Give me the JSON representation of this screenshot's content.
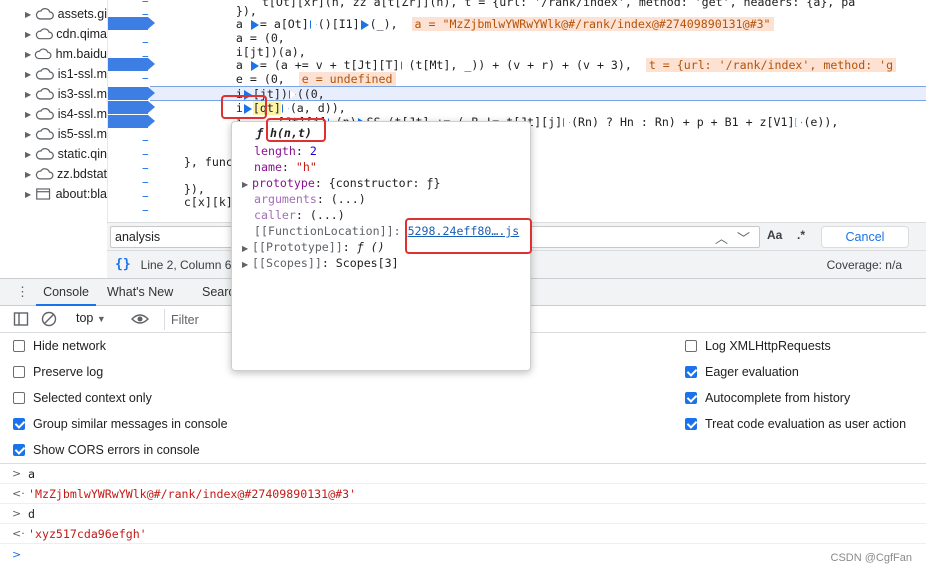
{
  "file_tree": {
    "items": [
      {
        "label": "assets.gi",
        "icon": "cloud-icon"
      },
      {
        "label": "cdn.qima",
        "icon": "cloud-icon"
      },
      {
        "label": "hm.baidu",
        "icon": "cloud-icon"
      },
      {
        "label": "is1-ssl.m",
        "icon": "cloud-icon"
      },
      {
        "label": "is3-ssl.m",
        "icon": "cloud-icon"
      },
      {
        "label": "is4-ssl.m",
        "icon": "cloud-icon"
      },
      {
        "label": "is5-ssl.m",
        "icon": "cloud-icon"
      },
      {
        "label": "static.qin",
        "icon": "cloud-icon"
      },
      {
        "label": "zz.bdstat",
        "icon": "cloud-icon"
      },
      {
        "label": "about:bla",
        "icon": "frame-icon"
      }
    ]
  },
  "code": {
    "lines": [
      "    t[Ot][xr](n, zz a[t[Zr]](n), t = {url: '/rank/index', method: 'get', headers: {a}, pa",
      "    }),",
      "    a ",
      "    a = (0,",
      "    i[jt])(a),",
      "    a ",
      "    e = (0,  ",
      "    i",
      "    i",
      "    i",
      "        } c",
      "    }, func",
      "        ret",
      "    }),",
      "    c[x][k]",
      "        sho"
    ],
    "line_a_expr": "= a[Ot]",
    "line_a_expr2": "()[I1]",
    "line_a_expr3": "(_),",
    "line_a_val": "a = \"MzZjbmlwYWRwYWlk@#/rank/index@#27409890131@#3\"",
    "line_v_expr": "= (a += v + t[Jt][T]",
    "line_v_expr2": "(t[Mt], _)) + (v + r) + (v + 3),",
    "line_v_val": "t = {url: '/rank/index', method: 'g",
    "line_e_val": "e = undefined",
    "line_jt": "[jt])",
    "line_jt2": "((0,",
    "line_qt": "[qt]",
    "line_qt2": "(a, d)),",
    "line_last": "[Jt][j]",
    "line_last2": "(Rn) ? Hn : Rn) + p + B1 + z[V1]",
    "line_last3": "(e)),",
    "line_last_pre": "     [Jt][j]",
    "line_last_mid": "(n)",
    "line_last_ss": "SS (t[Jt] += (-B != t[Jt][j]"
  },
  "popover": {
    "header_f": "ƒ",
    "header_sig": "h(n,t)",
    "length_key": "length",
    "length_val": "2",
    "name_key": "name",
    "name_val": "\"h\"",
    "prototype_key": "prototype",
    "prototype_val": "{constructor: ƒ}",
    "arguments_key": "arguments",
    "arguments_val": "(...)",
    "caller_key": "caller",
    "caller_val": "(...)",
    "fn_location_key": "[[FunctionLocation]]:",
    "fn_location_val": "5298.24eff80….js",
    "proto_key": "[[Prototype]]",
    "proto_val": "ƒ ()",
    "scopes_key": "[[Scopes]]",
    "scopes_val": "Scopes[3]"
  },
  "search": {
    "value": "analysis",
    "case_label": "Aa",
    "regex_label": ".*",
    "cancel_label": "Cancel"
  },
  "status": {
    "cursor": "Line 2, Column 6",
    "coverage": "Coverage: n/a"
  },
  "drawer": {
    "tabs": [
      "Console",
      "What's New",
      "Search"
    ],
    "context": "top",
    "filter_placeholder": "Filter"
  },
  "settings": {
    "left": [
      {
        "label": "Hide network",
        "checked": false
      },
      {
        "label": "Preserve log",
        "checked": false
      },
      {
        "label": "Selected context only",
        "checked": false
      },
      {
        "label": "Group similar messages in console",
        "checked": true
      },
      {
        "label": "Show CORS errors in console",
        "checked": true
      }
    ],
    "right": [
      {
        "label": "Log XMLHttpRequests",
        "checked": false
      },
      {
        "label": "Eager evaluation",
        "checked": true
      },
      {
        "label": "Autocomplete from history",
        "checked": true
      },
      {
        "label": "Treat code evaluation as user action",
        "checked": true
      }
    ]
  },
  "console": {
    "entries": [
      {
        "kind": "input",
        "text": "a"
      },
      {
        "kind": "output",
        "text": "'MzZjbmlwYWRwYWlk@#/rank/index@#27409890131@#3'"
      },
      {
        "kind": "input",
        "text": "d"
      },
      {
        "kind": "output",
        "text": "'xyz517cda96efgh'"
      }
    ]
  },
  "watermark": "CSDN @CgfFan",
  "colors": {
    "accent": "#1a73e8",
    "breakpoint": "#3d7ee5",
    "annotation_red": "#e03131",
    "string_red": "#c41a16"
  }
}
